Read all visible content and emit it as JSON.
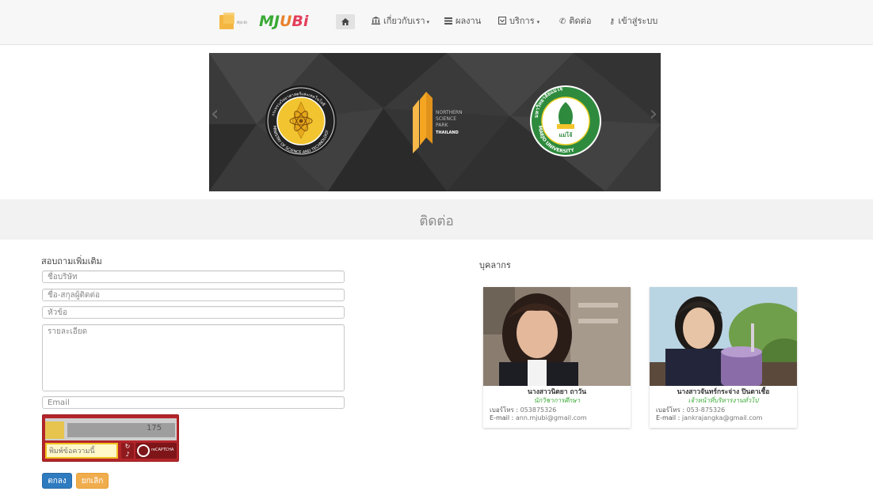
{
  "nav": {
    "brand_tag": "MJU-BI",
    "logo_text_1": "MJ",
    "logo_text_2": "U",
    "logo_text_3": "Bi",
    "home_icon": "home-icon",
    "items": [
      {
        "label": "เกี่ยวกับเรา",
        "icon": "bank-icon",
        "caret": true
      },
      {
        "label": "ผลงาน",
        "icon": "list-icon",
        "caret": false
      },
      {
        "label": "บริการ",
        "icon": "box-icon",
        "caret": true
      },
      {
        "label": "ติดต่อ",
        "icon": "phone-icon",
        "caret": false
      },
      {
        "label": "เข้าสู่ระบบ",
        "icon": "key-icon",
        "caret": false
      }
    ]
  },
  "slider": {
    "logo_left_text": "MINISTRY OF SCIENCE AND TECHNOLOGY",
    "logo_left_thai": "กระทรวงวิทยาศาสตร์และเทคโนโลยี",
    "logo_center_lines": [
      "NORTHERN",
      "SCIENCE",
      "PARK",
      "THAILAND"
    ],
    "logo_right_text": "MAEJO UNIVERSITY",
    "logo_right_thai": "มหาวิทยาลัยแม่โจ้"
  },
  "section": {
    "title": "ติดต่อ"
  },
  "form": {
    "heading": "สอบถามเพิ่มเติม",
    "name_placeholder": "ชื่อบริษัท",
    "contact_placeholder": "ชื่อ-สกุลผู้ติดต่อ",
    "subject_placeholder": "หัวข้อ",
    "detail_placeholder": "รายละเอียด",
    "email_placeholder": "Email",
    "captcha_number": "175",
    "captcha_placeholder": "พิมพ์ข้อความนี้",
    "captcha_brand": "reCAPTCHA",
    "ok_label": "ตกลง",
    "cancel_label": "ยกเลิก"
  },
  "staff": {
    "heading": "บุคลากร",
    "people": [
      {
        "name": "นางสาวนิตยา ถาวัน",
        "role": "นักวิชาการศึกษา",
        "phone_label": "เบอร์โทร :",
        "phone": "053875326",
        "email_label": "E-mail :",
        "email": "ann.mjubi@gmail.com"
      },
      {
        "name": "นางสาวจันทร์กระจ่าง ปินตาเชื้อ",
        "role": "เจ้าหน้าที่บริหารงานทั่วไป",
        "phone_label": "เบอร์โทร :",
        "phone": "053-875326",
        "email_label": "E-mail :",
        "email": "jankrajangka@gmail.com"
      }
    ]
  }
}
